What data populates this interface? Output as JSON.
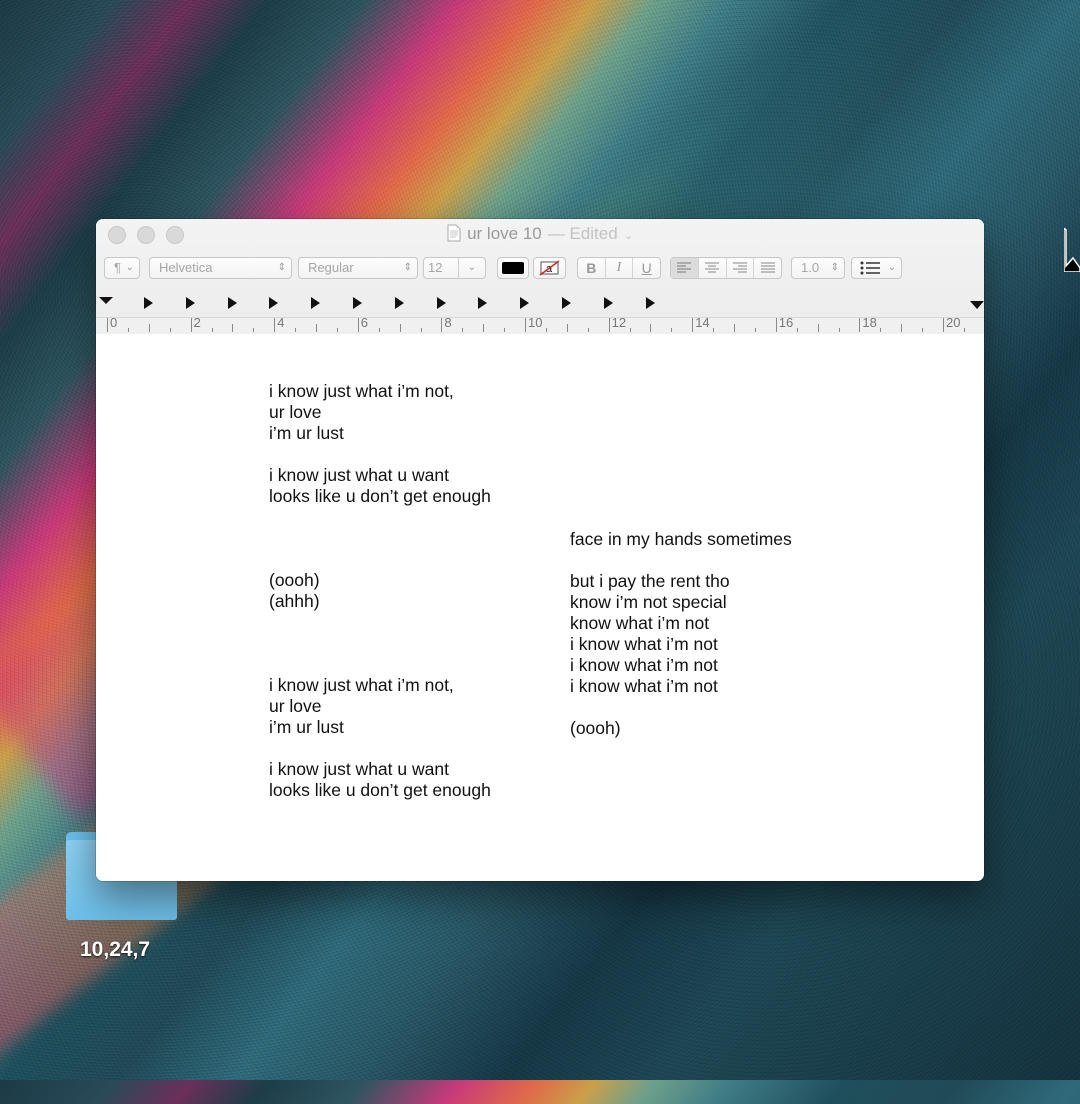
{
  "desktop": {
    "folder_label": "10,24,7"
  },
  "window": {
    "title": "ur love 10",
    "title_suffix": "— Edited",
    "toolbar": {
      "paragraph_style": "¶",
      "font_family": "Helvetica",
      "font_typeface": "Regular",
      "font_size": "12",
      "bold": "B",
      "italic": "I",
      "underline": "U",
      "line_spacing": "1.0",
      "text_color": "#000000",
      "alignment_selected": "left"
    },
    "ruler": {
      "labels": [
        "0",
        "2",
        "4",
        "6",
        "8",
        "10",
        "12",
        "14",
        "16",
        "18",
        "20"
      ]
    },
    "document": {
      "left_column": [
        "i know just what i’m not,",
        "ur love",
        "i’m ur lust",
        "",
        "i know just what u want",
        "looks like u don’t get enough",
        "",
        "",
        "",
        "(oooh)",
        "(ahhh)",
        "",
        "",
        "",
        "i know just what i’m not,",
        "ur love",
        "i’m ur lust",
        "",
        "i know just what u want",
        "looks like u don’t get enough"
      ],
      "right_column": [
        "face in my hands sometimes",
        "",
        "but i pay the rent tho",
        "know i’m not special",
        "know what i’m not",
        "i know what i’m not",
        "i know what i’m not",
        "i know what i’m not",
        "",
        "(oooh)"
      ]
    }
  }
}
